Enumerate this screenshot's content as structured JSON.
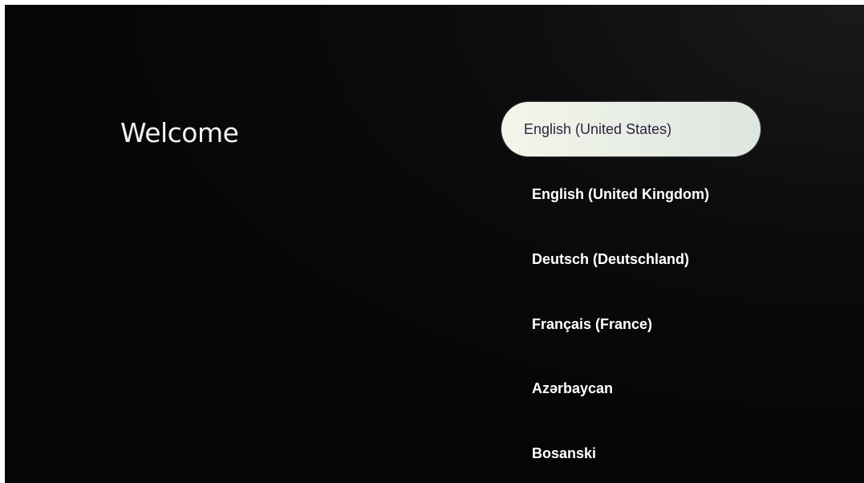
{
  "screen": {
    "title": "Welcome"
  },
  "languages": [
    {
      "label": "English (United States)",
      "selected": true
    },
    {
      "label": "English (United Kingdom)",
      "selected": false
    },
    {
      "label": "Deutsch (Deutschland)",
      "selected": false
    },
    {
      "label": "Français (France)",
      "selected": false
    },
    {
      "label": "Azərbaycan",
      "selected": false
    },
    {
      "label": "Bosanski",
      "selected": false
    }
  ],
  "colors": {
    "background": "#050505",
    "text": "#ffffff",
    "selected_pill": "#e6ece4",
    "selected_text": "#2c2340"
  }
}
